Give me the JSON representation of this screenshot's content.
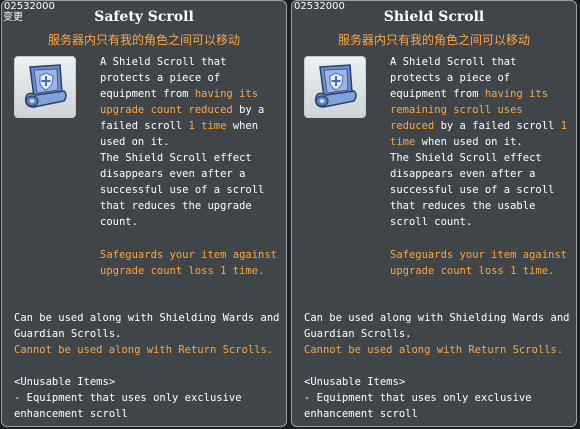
{
  "tooltips": [
    {
      "item_id": "02532000",
      "change_flag": "变更",
      "title": "Safety Scroll",
      "subtitle": "服务器内只有我的角色之间可以移动",
      "icon": "shield-scroll-icon",
      "desc": [
        "A Shield Scroll that protects a piece of equipment from ",
        "having its upgrade count reduced",
        " by a failed scroll ",
        "1 time",
        " when used on it.\nThe Shield Scroll effect disappears even after a successful use of a scroll that reduces the upgrade count."
      ],
      "safeguard": "Safeguards your item against upgrade count loss 1 time.",
      "compat_yes": "Can be used along with Shielding Wards and Guardian Scrolls.",
      "compat_no": "Cannot be used along with Return Scrolls.",
      "unusable_header": "<Unusable Items>",
      "unusable_item": "- Equipment that uses only exclusive enhancement scroll"
    },
    {
      "item_id": "02532000",
      "title": "Shield Scroll",
      "subtitle": "服务器内只有我的角色之间可以移动",
      "icon": "shield-scroll-icon",
      "desc": [
        "A Shield Scroll that protects a piece of equipment from ",
        "having its remaining scroll uses reduced",
        " by a failed scroll ",
        "1 time",
        " when used on it.\nThe Shield Scroll effect disappears even after a successful use of a scroll that reduces the usable scroll count."
      ],
      "safeguard": "Safeguards your item against upgrade count loss 1 time.",
      "compat_yes": "Can be used along with Shielding Wards and Guardian Scrolls.",
      "compat_no": "Cannot be used along with Return Scrolls.",
      "unusable_header": "<Unusable Items>",
      "unusable_item": "- Equipment that uses only exclusive enhancement scroll"
    }
  ],
  "colors": {
    "highlight": "#ffa640",
    "text": "#ffffff",
    "panel": "#3f4549"
  }
}
